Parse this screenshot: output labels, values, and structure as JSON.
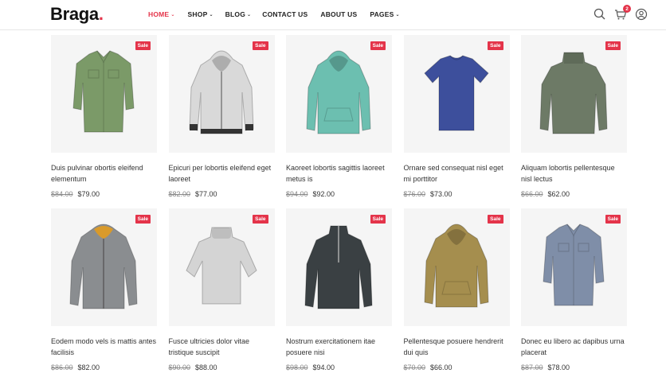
{
  "brand": {
    "name": "Braga",
    "dot": "."
  },
  "nav": [
    {
      "label": "HOME",
      "active": true,
      "dropdown": true
    },
    {
      "label": "SHOP",
      "active": false,
      "dropdown": true
    },
    {
      "label": "BLOG",
      "active": false,
      "dropdown": true
    },
    {
      "label": "CONTACT US",
      "active": false,
      "dropdown": false
    },
    {
      "label": "ABOUT US",
      "active": false,
      "dropdown": false
    },
    {
      "label": "PAGES",
      "active": false,
      "dropdown": true
    }
  ],
  "header": {
    "cart_count": "2",
    "icons": [
      "search-icon",
      "cart-icon",
      "user-icon"
    ]
  },
  "colors": {
    "accent": "#e4344a",
    "thumb_bg": "#f5f5f5"
  },
  "products": [
    {
      "title": "Duis pulvinar obortis eleifend elementum",
      "old_price": "$84.00",
      "price": "$79.00",
      "badge": "Sale",
      "kind": "shirt",
      "color": "#7b9a68"
    },
    {
      "title": "Epicuri per lobortis eleifend eget laoreet",
      "old_price": "$82.00",
      "price": "$77.00",
      "badge": "Sale",
      "kind": "zip-hoodie",
      "color": "#d9d9d9"
    },
    {
      "title": "Kaoreet lobortis sagittis laoreet metus is",
      "old_price": "$94.00",
      "price": "$92.00",
      "badge": "Sale",
      "kind": "hoodie",
      "color": "#6cbfb0"
    },
    {
      "title": "Ornare sed consequat nisl eget mi porttitor",
      "old_price": "$76.00",
      "price": "$73.00",
      "badge": "Sale",
      "kind": "tshirt",
      "color": "#3d4f9c"
    },
    {
      "title": "Aliquam lobortis pellentesque nisl lectus",
      "old_price": "$66.00",
      "price": "$62.00",
      "badge": "Sale",
      "kind": "sweater",
      "color": "#6d7a66"
    },
    {
      "title": "Eodem modo vels is mattis antes facilisis",
      "old_price": "$86.00",
      "price": "$82.00",
      "badge": "Sale",
      "kind": "jacket",
      "color": "#8a8d90"
    },
    {
      "title": "Fusce ultricies dolor vitae tristique suscipit",
      "old_price": "$90.00",
      "price": "$88.00",
      "badge": "Sale",
      "kind": "pullover",
      "color": "#d4d4d4"
    },
    {
      "title": "Nostrum exercitationem itae posuere nisi",
      "old_price": "$98.00",
      "price": "$94.00",
      "badge": "Sale",
      "kind": "fleece",
      "color": "#3a4043"
    },
    {
      "title": "Pellentesque posuere hendrerit dui quis",
      "old_price": "$70.00",
      "price": "$66.00",
      "badge": "Sale",
      "kind": "hoodie",
      "color": "#a58e4e"
    },
    {
      "title": "Donec eu libero ac dapibus urna placerat",
      "old_price": "$87.00",
      "price": "$78.00",
      "badge": "Sale",
      "kind": "shirt",
      "color": "#7f8ea8"
    }
  ]
}
